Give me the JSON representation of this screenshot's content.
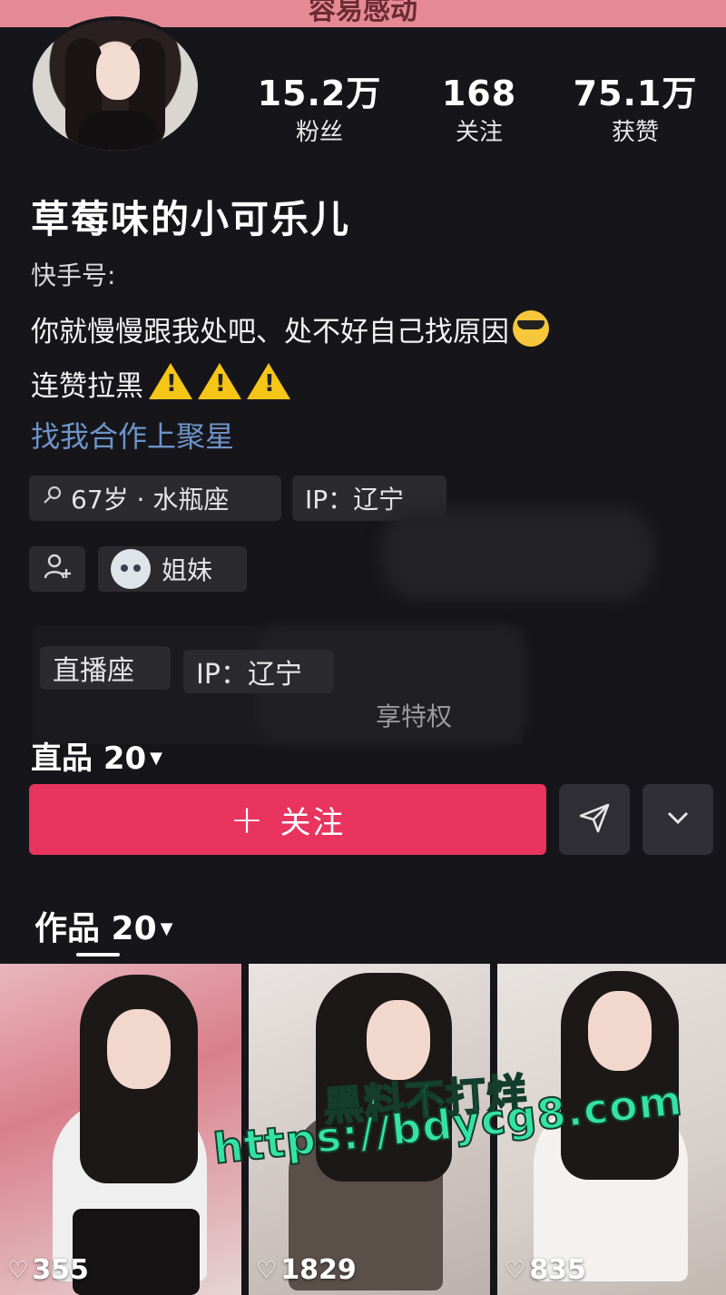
{
  "banner": {
    "text": "容易感动"
  },
  "profile": {
    "name": "草莓味的小可乐儿",
    "kuaishou_id_label": "快手号:",
    "bio_line1": "你就慢慢跟我处吧、处不好自己找原因",
    "bio_line2": "连赞拉黑",
    "collab_link": "找我合作上聚星"
  },
  "stats": [
    {
      "value": "15.2万",
      "label": "粉丝"
    },
    {
      "value": "168",
      "label": "关注"
    },
    {
      "value": "75.1万",
      "label": "获赞"
    }
  ],
  "chips": {
    "age_zodiac": "67岁 · 水瓶座",
    "ip": "IP：辽宁",
    "sister": "姐妹"
  },
  "ghost_overlay": {
    "chip1": "直播座",
    "chip2": "IP：辽宁",
    "text": "享特权",
    "works_label": "直品 20"
  },
  "actions": {
    "follow_label": "关注"
  },
  "tabs": {
    "works_label": "作品 20"
  },
  "videos": [
    {
      "likes": "355"
    },
    {
      "likes": "1829"
    },
    {
      "likes": "835"
    }
  ],
  "watermark": {
    "line1": "黑料不打烊",
    "line2": "https://bdycg8.com"
  },
  "colors": {
    "background": "#16161a",
    "accent": "#e8345e",
    "link": "#6e94c9",
    "watermark": "#34e3a4"
  },
  "icons": {
    "age": "search-person-icon",
    "add_friend": "add-friend-icon",
    "share": "paper-plane-icon",
    "more": "chevron-down-icon",
    "heart": "heart-outline-icon"
  }
}
